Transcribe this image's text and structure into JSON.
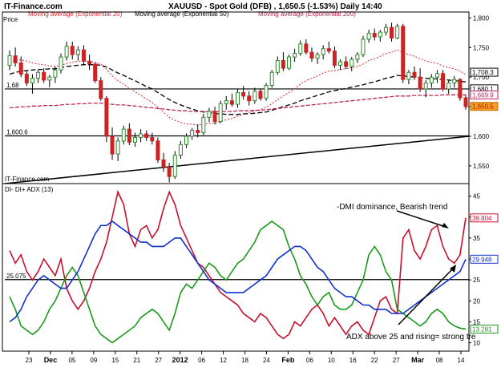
{
  "header": {
    "site": "IT-Finance.com",
    "title": "XAUUSD - Spot Gold (DFB) , 1,650.5 (-1.53%) Daily 14:40",
    "ma1": "Moving average (Exponential 20)",
    "ma2": "Moving average (Exponential 50)",
    "ma3": "Moving average (Exponential 200)",
    "price_label": "Price",
    "watermark": "IT-Finance.com"
  },
  "colors": {
    "ema20": "#e0262e",
    "ema50": "#000000",
    "ema200": "#c0205a",
    "di_minus": "#c8102e",
    "di_plus": "#1a9a1a",
    "adx": "#1030d0",
    "bull_candle": "#2e8b2e",
    "bear_candle": "#cc2222"
  },
  "chart_data": [
    {
      "type": "candlestick",
      "title": "XAUUSD - Spot Gold (DFB) , 1,650.5 (-1.53%) Daily 14:40",
      "ylabel": "Price",
      "ylim": [
        1520,
        1810
      ],
      "ytick_labels": [
        "1,800",
        "1,750",
        "1,700",
        "1,650",
        "1,600",
        "1,550"
      ],
      "yticks": [
        1800,
        1750,
        1700,
        1650,
        1600,
        1550
      ],
      "xtick_labels": [
        "23",
        "Dec",
        "05",
        "09",
        "15",
        "21",
        "27",
        "2012",
        "06",
        "12",
        "18",
        "24",
        "Feb",
        "06",
        "10",
        "16",
        "22",
        "27",
        "Mar",
        "08",
        "14"
      ],
      "price_tags": [
        {
          "label": "1,708.3",
          "value": 1708.3
        },
        {
          "label": "1,680.1",
          "value": 1680.1
        },
        {
          "label": "1,669.9",
          "value": 1669.9
        },
        {
          "label": "1,650.5",
          "value": 1650.5
        }
      ],
      "hlines": [
        {
          "label": "1,68",
          "value": 1680
        },
        {
          "label": "1,600.6",
          "value": 1600.6
        }
      ],
      "trendline": {
        "from": 1520,
        "to": 1600
      },
      "candles": [
        [
          1720,
          1745,
          1712,
          1736
        ],
        [
          1736,
          1750,
          1718,
          1724
        ],
        [
          1724,
          1735,
          1700,
          1705
        ],
        [
          1705,
          1712,
          1685,
          1690
        ],
        [
          1690,
          1705,
          1672,
          1698
        ],
        [
          1698,
          1712,
          1690,
          1708
        ],
        [
          1708,
          1715,
          1690,
          1695
        ],
        [
          1695,
          1704,
          1683,
          1700
        ],
        [
          1700,
          1718,
          1690,
          1712
        ],
        [
          1712,
          1740,
          1706,
          1734
        ],
        [
          1734,
          1760,
          1728,
          1752
        ],
        [
          1752,
          1760,
          1730,
          1738
        ],
        [
          1738,
          1752,
          1728,
          1746
        ],
        [
          1746,
          1754,
          1720,
          1727
        ],
        [
          1727,
          1738,
          1712,
          1722
        ],
        [
          1722,
          1724,
          1690,
          1694
        ],
        [
          1694,
          1700,
          1660,
          1664
        ],
        [
          1664,
          1668,
          1590,
          1600
        ],
        [
          1600,
          1615,
          1560,
          1570
        ],
        [
          1570,
          1598,
          1558,
          1592
        ],
        [
          1592,
          1618,
          1586,
          1612
        ],
        [
          1612,
          1622,
          1585,
          1590
        ],
        [
          1590,
          1606,
          1582,
          1598
        ],
        [
          1598,
          1612,
          1590,
          1604
        ],
        [
          1604,
          1610,
          1592,
          1598
        ],
        [
          1598,
          1606,
          1586,
          1592
        ],
        [
          1592,
          1598,
          1555,
          1560
        ],
        [
          1560,
          1572,
          1540,
          1548
        ],
        [
          1548,
          1555,
          1522,
          1532
        ],
        [
          1532,
          1575,
          1528,
          1568
        ],
        [
          1568,
          1592,
          1562,
          1586
        ],
        [
          1586,
          1605,
          1580,
          1600
        ],
        [
          1600,
          1614,
          1594,
          1610
        ],
        [
          1610,
          1620,
          1598,
          1606
        ],
        [
          1606,
          1638,
          1602,
          1632
        ],
        [
          1632,
          1648,
          1624,
          1642
        ],
        [
          1642,
          1650,
          1620,
          1625
        ],
        [
          1625,
          1660,
          1622,
          1655
        ],
        [
          1655,
          1668,
          1645,
          1660
        ],
        [
          1660,
          1672,
          1650,
          1654
        ],
        [
          1654,
          1680,
          1648,
          1674
        ],
        [
          1674,
          1685,
          1662,
          1668
        ],
        [
          1668,
          1676,
          1652,
          1660
        ],
        [
          1660,
          1682,
          1655,
          1676
        ],
        [
          1676,
          1680,
          1660,
          1664
        ],
        [
          1664,
          1690,
          1660,
          1686
        ],
        [
          1686,
          1712,
          1682,
          1708
        ],
        [
          1708,
          1735,
          1704,
          1728
        ],
        [
          1728,
          1742,
          1710,
          1715
        ],
        [
          1715,
          1738,
          1712,
          1734
        ],
        [
          1734,
          1748,
          1726,
          1740
        ],
        [
          1740,
          1762,
          1736,
          1756
        ],
        [
          1756,
          1764,
          1738,
          1742
        ],
        [
          1742,
          1750,
          1726,
          1732
        ],
        [
          1732,
          1742,
          1722,
          1738
        ],
        [
          1738,
          1754,
          1730,
          1748
        ],
        [
          1748,
          1760,
          1740,
          1744
        ],
        [
          1744,
          1752,
          1715,
          1720
        ],
        [
          1720,
          1730,
          1712,
          1726
        ],
        [
          1726,
          1735,
          1714,
          1718
        ],
        [
          1718,
          1734,
          1710,
          1730
        ],
        [
          1730,
          1742,
          1724,
          1738
        ],
        [
          1738,
          1770,
          1734,
          1764
        ],
        [
          1764,
          1780,
          1758,
          1774
        ],
        [
          1774,
          1782,
          1762,
          1768
        ],
        [
          1768,
          1780,
          1760,
          1776
        ],
        [
          1776,
          1790,
          1770,
          1784
        ],
        [
          1784,
          1792,
          1760,
          1766
        ],
        [
          1766,
          1790,
          1764,
          1786
        ],
        [
          1786,
          1790,
          1690,
          1696
        ],
        [
          1696,
          1712,
          1688,
          1708
        ],
        [
          1708,
          1718,
          1695,
          1700
        ],
        [
          1700,
          1715,
          1675,
          1680
        ],
        [
          1680,
          1695,
          1666,
          1690
        ],
        [
          1690,
          1705,
          1682,
          1700
        ],
        [
          1700,
          1712,
          1690,
          1706
        ],
        [
          1706,
          1712,
          1676,
          1680
        ],
        [
          1680,
          1694,
          1672,
          1690
        ],
        [
          1690,
          1702,
          1682,
          1696
        ],
        [
          1696,
          1698,
          1660,
          1665
        ],
        [
          1665,
          1670,
          1645,
          1650
        ]
      ],
      "series": [
        {
          "name": "Moving average (Exponential 20)",
          "values": [
            1728,
            1729,
            1729,
            1727,
            1724,
            1722,
            1721,
            1719,
            1718,
            1720,
            1723,
            1725,
            1727,
            1727,
            1726,
            1725,
            1722,
            1713,
            1702,
            1694,
            1688,
            1681,
            1675,
            1669,
            1663,
            1657,
            1649,
            1641,
            1632,
            1627,
            1623,
            1621,
            1620,
            1619,
            1620,
            1622,
            1622,
            1625,
            1628,
            1630,
            1634,
            1637,
            1640,
            1643,
            1645,
            1649,
            1655,
            1662,
            1668,
            1674,
            1680,
            1688,
            1694,
            1698,
            1702,
            1707,
            1710,
            1711,
            1713,
            1714,
            1716,
            1718,
            1722,
            1728,
            1731,
            1735,
            1740,
            1742,
            1746,
            1741,
            1738,
            1735,
            1731,
            1727,
            1725,
            1723,
            1719,
            1716,
            1714,
            1710,
            1704
          ]
        },
        {
          "name": "Moving average (Exponential 50)",
          "values": [
            1705,
            1708,
            1710,
            1711,
            1712,
            1713,
            1713,
            1714,
            1714,
            1716,
            1718,
            1719,
            1720,
            1721,
            1721,
            1721,
            1720,
            1717,
            1712,
            1707,
            1703,
            1698,
            1694,
            1689,
            1684,
            1680,
            1674,
            1668,
            1662,
            1657,
            1653,
            1649,
            1646,
            1643,
            1641,
            1640,
            1638,
            1638,
            1637,
            1637,
            1637,
            1638,
            1638,
            1639,
            1640,
            1641,
            1644,
            1647,
            1650,
            1653,
            1656,
            1660,
            1663,
            1666,
            1669,
            1672,
            1675,
            1677,
            1679,
            1681,
            1683,
            1685,
            1687,
            1690,
            1692,
            1695,
            1698,
            1700,
            1703,
            1702,
            1701,
            1700,
            1699,
            1698,
            1697,
            1697,
            1696,
            1695,
            1694,
            1693,
            1692
          ]
        },
        {
          "name": "Moving average (Exponential 200)",
          "values": [
            1648,
            1649,
            1650,
            1650,
            1651,
            1651,
            1652,
            1652,
            1652,
            1653,
            1654,
            1654,
            1655,
            1655,
            1656,
            1656,
            1656,
            1655,
            1654,
            1653,
            1653,
            1652,
            1651,
            1650,
            1649,
            1648,
            1647,
            1646,
            1645,
            1644,
            1643,
            1643,
            1642,
            1642,
            1642,
            1642,
            1642,
            1642,
            1642,
            1642,
            1643,
            1643,
            1643,
            1644,
            1644,
            1645,
            1646,
            1647,
            1648,
            1649,
            1650,
            1651,
            1652,
            1653,
            1654,
            1655,
            1656,
            1657,
            1658,
            1659,
            1660,
            1661,
            1662,
            1663,
            1664,
            1665,
            1666,
            1667,
            1668,
            1668,
            1668,
            1669,
            1669,
            1669,
            1669,
            1669,
            1670,
            1670,
            1670,
            1670,
            1670
          ]
        }
      ]
    },
    {
      "type": "line",
      "title": "DI- DI+ ADX (13)",
      "ylim": [
        8,
        48
      ],
      "ytick_labels": [
        "45",
        "40",
        "35",
        "30",
        "25",
        "20",
        "15",
        "10"
      ],
      "yticks": [
        45,
        40,
        35,
        30,
        25,
        20,
        15,
        10
      ],
      "xtick_labels": [
        "23",
        "Dec",
        "05",
        "09",
        "15",
        "21",
        "27",
        "2012",
        "06",
        "12",
        "18",
        "24",
        "Feb",
        "06",
        "10",
        "16",
        "22",
        "27",
        "Mar",
        "08",
        "14"
      ],
      "threshold": {
        "label": "25.075",
        "value": 25.075
      },
      "last_values": [
        {
          "label": "39.804",
          "value": 39.804
        },
        {
          "label": "29.948",
          "value": 29.948
        },
        {
          "label": "13.281",
          "value": 13.281
        }
      ],
      "annotations": [
        {
          "text": "-DMI dominance, Bearish trend"
        },
        {
          "text": "ADX above 25 and rising= strong tre"
        }
      ],
      "series": [
        {
          "name": "DI-",
          "values": [
            32,
            29,
            31,
            27,
            25,
            27,
            30,
            28,
            26,
            30,
            23,
            20,
            18,
            20,
            23,
            27,
            30,
            34,
            40,
            46,
            43,
            36,
            33,
            37,
            38,
            35,
            37,
            42,
            46,
            43,
            38,
            35,
            32,
            29,
            28,
            26,
            24,
            22,
            21,
            20,
            19,
            17,
            16,
            15,
            17,
            16,
            14,
            12,
            11,
            12,
            15,
            14,
            16,
            18,
            19,
            17,
            14,
            16,
            14,
            12,
            14,
            15,
            13,
            12,
            16,
            20,
            21,
            18,
            17,
            35,
            37,
            32,
            30,
            33,
            37,
            38,
            33,
            30,
            29,
            31,
            39.8
          ]
        },
        {
          "name": "DI+",
          "values": [
            21,
            18,
            14,
            13,
            12,
            13,
            15,
            18,
            20,
            23,
            26,
            28,
            26,
            22,
            18,
            14,
            12,
            11,
            10,
            11,
            12,
            13,
            14,
            16,
            17,
            18,
            17,
            15,
            13,
            17,
            22,
            24,
            23,
            25,
            27,
            29,
            28,
            26,
            25,
            27,
            29,
            30,
            32,
            34,
            37,
            38,
            39,
            38,
            37,
            33,
            30,
            26,
            24,
            21,
            19,
            21,
            22,
            19,
            18,
            18,
            19,
            22,
            25,
            31,
            33,
            31,
            27,
            25,
            18,
            17,
            16,
            15,
            14,
            15,
            17,
            18,
            17,
            15,
            14,
            13.5,
            13.28
          ]
        },
        {
          "name": "ADX",
          "values": [
            15,
            16,
            18,
            21,
            23,
            25,
            26,
            25,
            24,
            23,
            23,
            25,
            27,
            30,
            33,
            36,
            38,
            38,
            39,
            38,
            37,
            36,
            35,
            34,
            34,
            33,
            33,
            33,
            34,
            35,
            35,
            33,
            31,
            29,
            27,
            25,
            24,
            23,
            22,
            22,
            22,
            22,
            23,
            24,
            25,
            26,
            28,
            30,
            31,
            32,
            33,
            33,
            32,
            30,
            28,
            27,
            25,
            23,
            22,
            21,
            21,
            20,
            19,
            19,
            18,
            18,
            18,
            17,
            17,
            17,
            18,
            19,
            20,
            21,
            22,
            23,
            24,
            25,
            26,
            27,
            29.95
          ]
        }
      ]
    }
  ]
}
